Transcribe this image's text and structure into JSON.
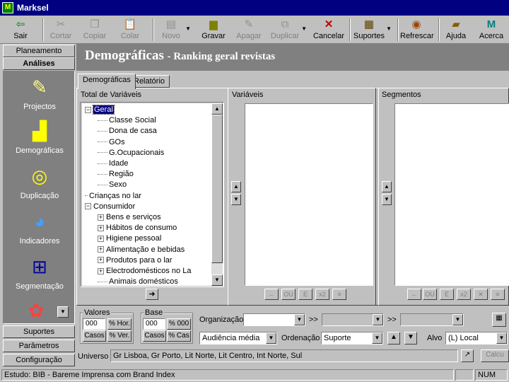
{
  "window": {
    "title": "Marksel",
    "icon": "marksel-app-icon"
  },
  "toolbar": {
    "items": [
      {
        "label": "Sair",
        "icon": "exit-icon",
        "enabled": true
      },
      {
        "label": "Cortar",
        "icon": "scissors-icon",
        "enabled": false
      },
      {
        "label": "Copiar",
        "icon": "copy-icon",
        "enabled": false
      },
      {
        "label": "Colar",
        "icon": "paste-icon",
        "enabled": false
      },
      {
        "label": "Novo",
        "icon": "new-icon",
        "enabled": false
      },
      {
        "label": "Gravar",
        "icon": "save-icon",
        "enabled": true
      },
      {
        "label": "Apagar",
        "icon": "erase-icon",
        "enabled": false
      },
      {
        "label": "Duplicar",
        "icon": "duplicate-icon",
        "enabled": false
      },
      {
        "label": "Cancelar",
        "icon": "cancel-icon",
        "enabled": true
      },
      {
        "label": "Suportes",
        "icon": "media-icon",
        "enabled": true
      },
      {
        "label": "Refrescar",
        "icon": "refresh-icon",
        "enabled": true
      },
      {
        "label": "Ajuda",
        "icon": "help-book-icon",
        "enabled": true
      },
      {
        "label": "Acerca",
        "icon": "about-icon",
        "enabled": true
      }
    ]
  },
  "sidebar": {
    "top_buttons": [
      "Planeamento",
      "Análises"
    ],
    "items": [
      {
        "label": "Projectos",
        "icon": "projects-icon"
      },
      {
        "label": "Demográficas",
        "icon": "demographics-icon"
      },
      {
        "label": "Duplicação",
        "icon": "duplication-icon"
      },
      {
        "label": "Indicadores",
        "icon": "indicators-icon"
      },
      {
        "label": "Segmentação",
        "icon": "segmentation-icon"
      }
    ],
    "bottom_buttons": [
      "Suportes",
      "Parâmetros",
      "Configuração"
    ]
  },
  "header": {
    "title": "Demográficas",
    "subtitle": "- Ranking geral revistas"
  },
  "tabs": [
    "Demográficas",
    "Relatório"
  ],
  "panes": {
    "total": "Total de Variáveis",
    "variables": "Variáveis",
    "segments": "Segmentos"
  },
  "tree": {
    "nodes": [
      {
        "label": "Geral",
        "level": 0,
        "expander": "−",
        "selected": true
      },
      {
        "label": "Classe Social",
        "level": 1
      },
      {
        "label": "Dona de casa",
        "level": 1
      },
      {
        "label": "GOs",
        "level": 1
      },
      {
        "label": "G.Ocupacionais",
        "level": 1
      },
      {
        "label": "Idade",
        "level": 1
      },
      {
        "label": "Região",
        "level": 1
      },
      {
        "label": "Sexo",
        "level": 1
      },
      {
        "label": "Crianças no lar",
        "level": 0
      },
      {
        "label": "Consumidor",
        "level": 0,
        "expander": "−"
      },
      {
        "label": "Bens e serviços",
        "level": 1,
        "expander": "+"
      },
      {
        "label": "Hábitos de consumo",
        "level": 1,
        "expander": "+"
      },
      {
        "label": "Higiene pessoal",
        "level": 1,
        "expander": "+"
      },
      {
        "label": "Alimentação e bebidas",
        "level": 1,
        "expander": "+"
      },
      {
        "label": "Produtos para o lar",
        "level": 1,
        "expander": "+"
      },
      {
        "label": "Electrodomésticos no La",
        "level": 1,
        "expander": "+"
      },
      {
        "label": "Animais domésticos",
        "level": 1
      }
    ]
  },
  "pane_buttons": {
    "variables": [
      "←",
      "OU",
      "E",
      "x2",
      "≡"
    ],
    "segments": [
      "←",
      "OU",
      "E",
      "x2",
      "✕",
      "≡"
    ]
  },
  "bottom": {
    "valores_label": "Valores",
    "valores_value": "000",
    "valores_btn1": "% Hor.",
    "valores_btn2": "Casos",
    "valores_btn3": "% Ver.",
    "base_label": "Base",
    "base_value": "000",
    "base_btn1": "% 000",
    "base_btn2": "Casos",
    "base_btn3": "% Cas",
    "organizacao_label": "Organização",
    "organizacao_value": "",
    "chev1": ">>",
    "chev2": ">>",
    "medida_value": "Audiência média",
    "ordenacao_label": "Ordenação",
    "ordenacao_value": "Suporte",
    "alvo_label": "Alvo",
    "alvo_value": "(L) Local",
    "calcular_label": "Calcu",
    "universo_label": "Universo",
    "universo_value": "Gr Lisboa, Gr Porto, Lit Norte, Lit Centro, Int Norte, Sul"
  },
  "status": {
    "study": "Estudo: BIB - Bareme Imprensa com Brand Index",
    "num": "NUM"
  }
}
